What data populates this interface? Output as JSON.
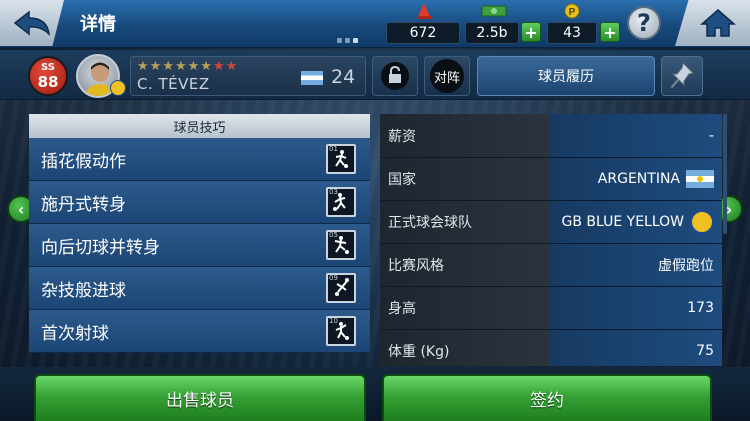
{
  "header": {
    "title": "详情",
    "resources": [
      {
        "icon": "cone-icon",
        "value": "672"
      },
      {
        "icon": "cash-icon",
        "value": "2.5b"
      },
      {
        "icon": "coin-icon",
        "value": "43"
      }
    ],
    "help_label": "?"
  },
  "player": {
    "position": "SS",
    "rating": "88",
    "stars_gold": 6,
    "stars_red": 2,
    "name": "C. TÉVEZ",
    "age": "24"
  },
  "actions": {
    "vs_label": "对阵",
    "history_label": "球员履历"
  },
  "skills": {
    "header": "球员技巧",
    "items": [
      {
        "label": "插花假动作",
        "num": "01"
      },
      {
        "label": "施丹式转身",
        "num": "03"
      },
      {
        "label": "向后切球并转身",
        "num": "05"
      },
      {
        "label": "杂技般进球",
        "num": "09"
      },
      {
        "label": "首次射球",
        "num": "10"
      }
    ]
  },
  "stats": [
    {
      "label": "薪资",
      "value": "-"
    },
    {
      "label": "国家",
      "value": "ARGENTINA"
    },
    {
      "label": "正式球会球队",
      "value": "GB BLUE YELLOW"
    },
    {
      "label": "比赛风格",
      "value": "虚假跑位"
    },
    {
      "label": "身高",
      "value": "173"
    },
    {
      "label": "体重 (Kg)",
      "value": "75"
    }
  ],
  "buttons": {
    "sell_label": "出售球员",
    "sign_label": "签约"
  },
  "colors": {
    "accent_green": "#35a135",
    "panel_blue": "#1b4575",
    "badge_red": "#a31c12"
  }
}
